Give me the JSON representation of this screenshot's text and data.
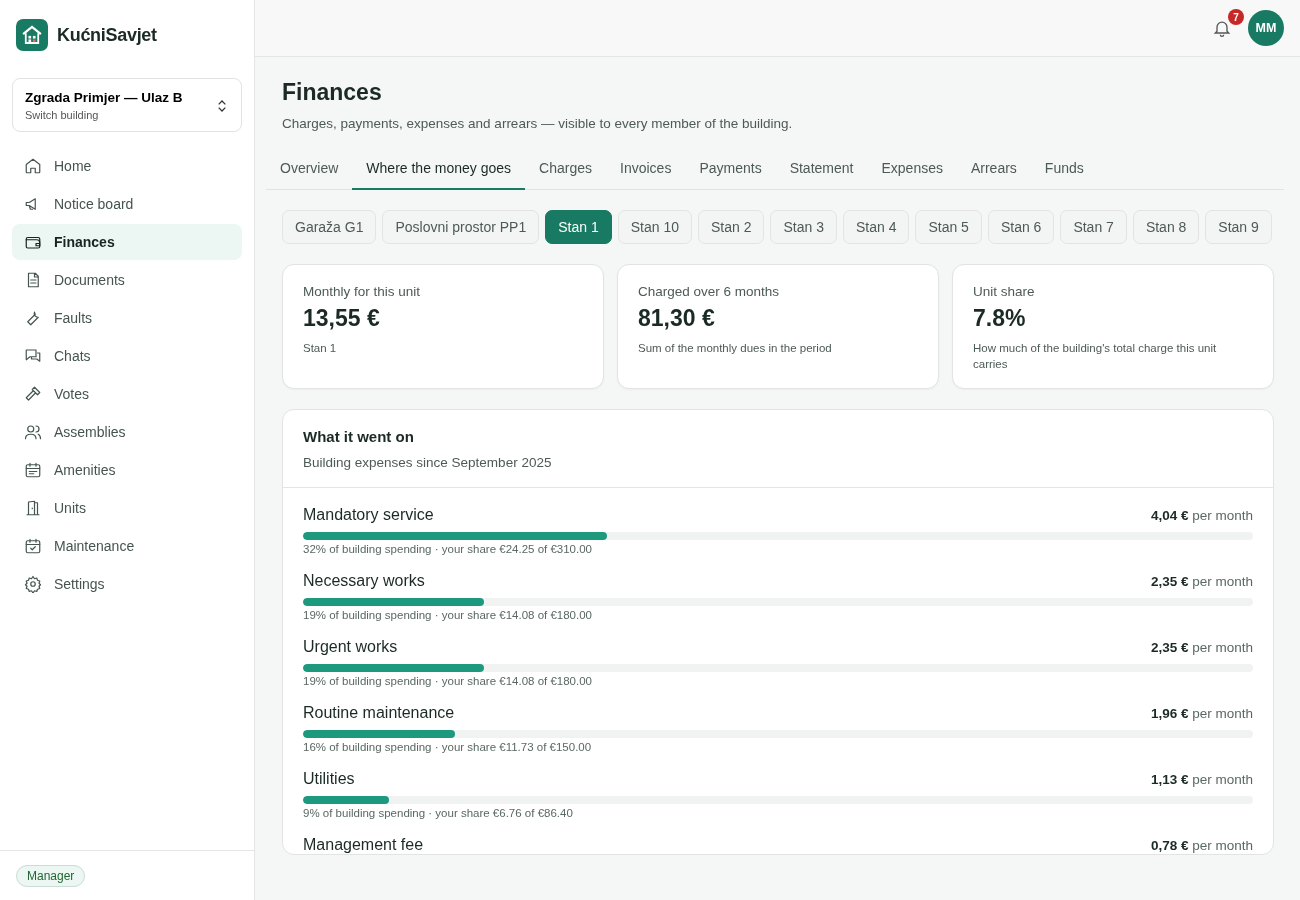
{
  "brand": {
    "name": "KućniSavjet"
  },
  "building_switcher": {
    "name": "Zgrada Primjer — Ulaz B",
    "hint": "Switch building"
  },
  "nav": [
    {
      "label": "Home",
      "selected": false
    },
    {
      "label": "Notice board",
      "selected": false
    },
    {
      "label": "Finances",
      "selected": true
    },
    {
      "label": "Documents",
      "selected": false
    },
    {
      "label": "Faults",
      "selected": false
    },
    {
      "label": "Chats",
      "selected": false
    },
    {
      "label": "Votes",
      "selected": false
    },
    {
      "label": "Assemblies",
      "selected": false
    },
    {
      "label": "Amenities",
      "selected": false
    },
    {
      "label": "Units",
      "selected": false
    },
    {
      "label": "Maintenance",
      "selected": false
    },
    {
      "label": "Settings",
      "selected": false
    }
  ],
  "role_badge": "Manager",
  "topbar": {
    "notifications": "7",
    "avatar": "MM"
  },
  "page": {
    "title": "Finances",
    "subtitle": "Charges, payments, expenses and arrears — visible to every member of the building."
  },
  "tabs": [
    {
      "label": "Overview",
      "selected": false
    },
    {
      "label": "Where the money goes",
      "selected": true
    },
    {
      "label": "Charges",
      "selected": false
    },
    {
      "label": "Invoices",
      "selected": false
    },
    {
      "label": "Payments",
      "selected": false
    },
    {
      "label": "Statement",
      "selected": false
    },
    {
      "label": "Expenses",
      "selected": false
    },
    {
      "label": "Arrears",
      "selected": false
    },
    {
      "label": "Funds",
      "selected": false
    }
  ],
  "units": [
    {
      "label": "Garaža G1",
      "selected": false
    },
    {
      "label": "Poslovni prostor PP1",
      "selected": false
    },
    {
      "label": "Stan 1",
      "selected": true
    },
    {
      "label": "Stan 10",
      "selected": false
    },
    {
      "label": "Stan 2",
      "selected": false
    },
    {
      "label": "Stan 3",
      "selected": false
    },
    {
      "label": "Stan 4",
      "selected": false
    },
    {
      "label": "Stan 5",
      "selected": false
    },
    {
      "label": "Stan 6",
      "selected": false
    },
    {
      "label": "Stan 7",
      "selected": false
    },
    {
      "label": "Stan 8",
      "selected": false
    },
    {
      "label": "Stan 9",
      "selected": false
    }
  ],
  "stats": [
    {
      "label": "Monthly for this unit",
      "value": "13,55 €",
      "note": "Stan 1"
    },
    {
      "label": "Charged over 6 months",
      "value": "81,30 €",
      "note": "Sum of the monthly dues in the period"
    },
    {
      "label": "Unit share",
      "value": "7.8%",
      "note": "How much of the building's total charge this unit carries"
    }
  ],
  "breakdown": {
    "title": "What it went on",
    "subtitle": "Building expenses since September 2025",
    "items": [
      {
        "name": "Mandatory service",
        "amount": "4,04 €",
        "unit": "per month",
        "level": 0.32,
        "detail": "32% of building spending · your share €24.25 of €310.00"
      },
      {
        "name": "Necessary works",
        "amount": "2,35 €",
        "unit": "per month",
        "level": 0.19,
        "detail": "19% of building spending · your share €14.08 of €180.00"
      },
      {
        "name": "Urgent works",
        "amount": "2,35 €",
        "unit": "per month",
        "level": 0.19,
        "detail": "19% of building spending · your share €14.08 of €180.00"
      },
      {
        "name": "Routine maintenance",
        "amount": "1,96 €",
        "unit": "per month",
        "level": 0.16,
        "detail": "16% of building spending · your share €11.73 of €150.00"
      },
      {
        "name": "Utilities",
        "amount": "1,13 €",
        "unit": "per month",
        "level": 0.09,
        "detail": "9% of building spending · your share €6.76 of €86.40"
      },
      {
        "name": "Management fee",
        "amount": "0,78 €",
        "unit": "per month"
      }
    ]
  }
}
